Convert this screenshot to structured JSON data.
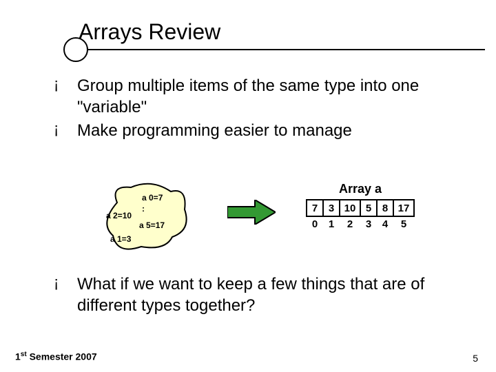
{
  "title": "Arrays Review",
  "bullets": {
    "b1": "Group multiple items of the same type into one \"variable\"",
    "b2": "Make programming easier to manage",
    "b3": "What if we want to keep a few things that are of different types together?"
  },
  "blob": {
    "a0": "a 0=7",
    "colon": ":",
    "a2": "a 2=10",
    "a5": "a 5=17",
    "a1": "a 1=3"
  },
  "array": {
    "title": "Array a",
    "cells": {
      "c0": "7",
      "c1": "3",
      "c2": "10",
      "c3": "5",
      "c4": "8",
      "c5": "17"
    },
    "idx": {
      "i0": "0",
      "i1": "1",
      "i2": "2",
      "i3": "3",
      "i4": "4",
      "i5": "5"
    }
  },
  "footer": {
    "semester_prefix": "1",
    "semester_suffix": "st",
    "semester_rest": " Semester 2007",
    "page": "5"
  }
}
